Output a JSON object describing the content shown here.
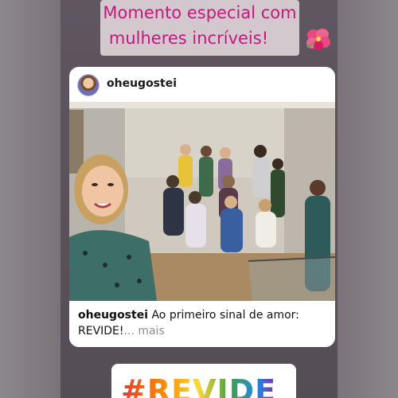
{
  "story": {
    "caption_line1": "Momento especial com",
    "caption_line2": "mulheres incríveis!",
    "caption_emoji": "hibiscus-flower"
  },
  "post": {
    "username": "oheugostei",
    "caption_user": "oheugostei",
    "caption_text": "Ao primeiro sinal de amor: REVIDE!",
    "more_label": "... mais"
  },
  "sticker": {
    "text": "#REVIDE"
  },
  "colors": {
    "caption_bg": "#d4c8cf",
    "caption_text": "#c21a7a",
    "story_bg": "#5a515b"
  }
}
